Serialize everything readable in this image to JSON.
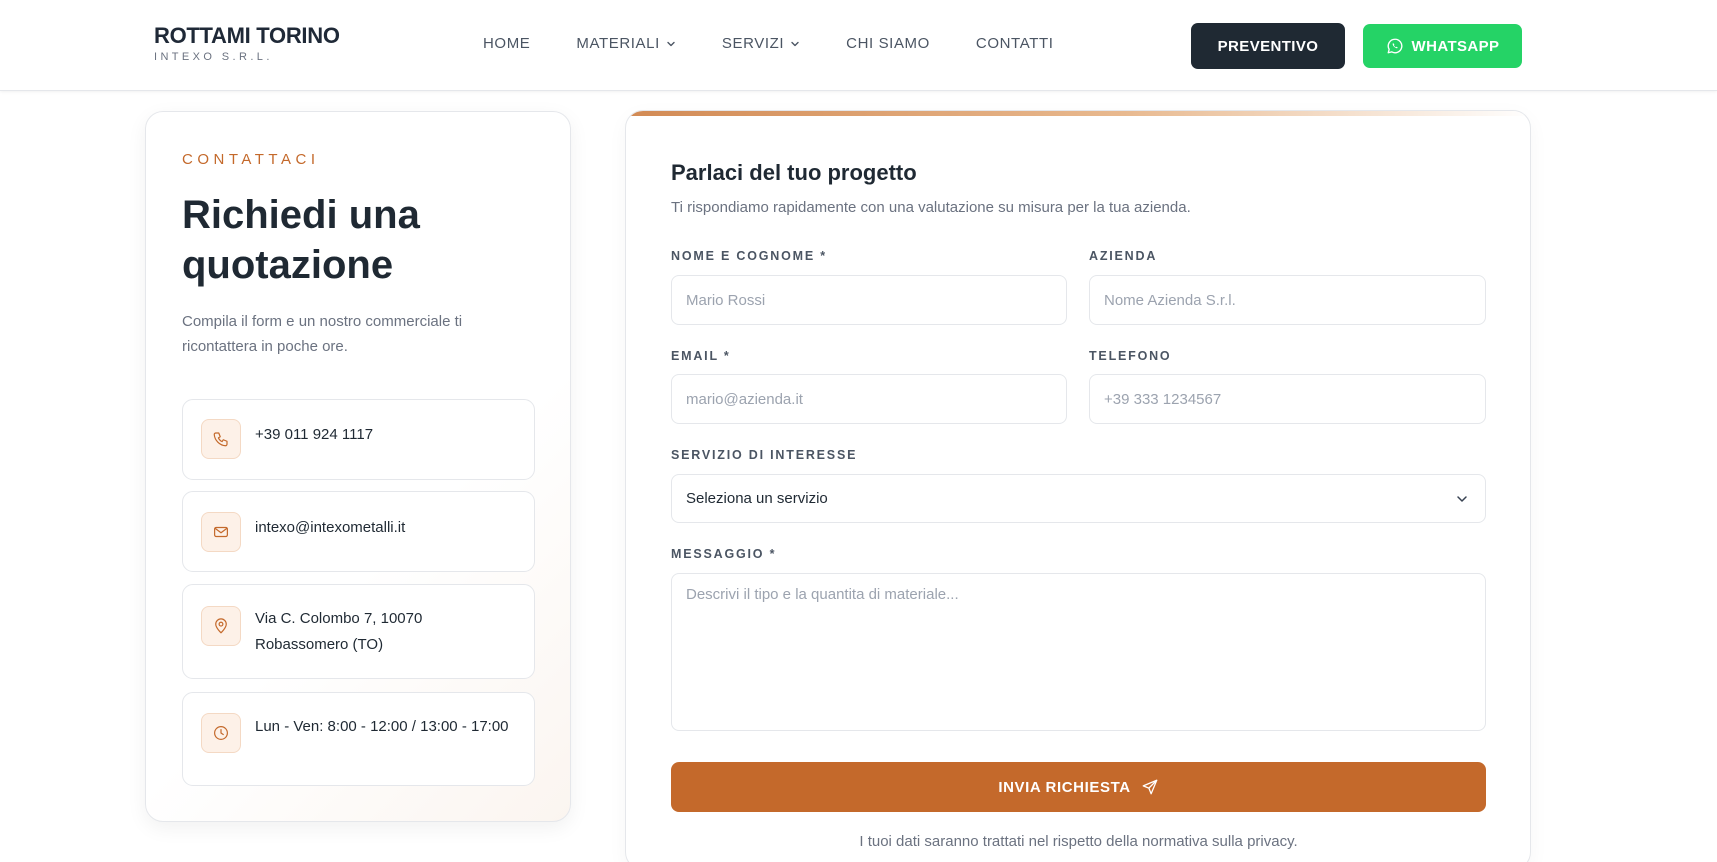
{
  "header": {
    "brand_name": "ROTTAMI TORINO",
    "brand_sub": "INTEXO S.R.L.",
    "nav": [
      {
        "label": "HOME",
        "dropdown": false
      },
      {
        "label": "MATERIALI",
        "dropdown": true
      },
      {
        "label": "SERVIZI",
        "dropdown": true
      },
      {
        "label": "CHI SIAMO",
        "dropdown": false
      },
      {
        "label": "CONTATTI",
        "dropdown": false
      }
    ],
    "preventivo_label": "PREVENTIVO",
    "whatsapp_label": "WHATSAPP"
  },
  "contact": {
    "eyebrow": "CONTATTACI",
    "title": "Richiedi una quotazione",
    "description": "Compila il form e un nostro commerciale ti ricontattera in poche ore.",
    "items": [
      {
        "icon": "phone-icon",
        "text": "+39 011 924 1117"
      },
      {
        "icon": "mail-icon",
        "text": "intexo@intexometalli.it"
      },
      {
        "icon": "location-pin-icon",
        "text": "Via C. Colombo 7, 10070 Robassomero (TO)"
      },
      {
        "icon": "clock-icon",
        "text": "Lun - Ven: 8:00 - 12:00 / 13:00 - 17:00"
      }
    ]
  },
  "form": {
    "title": "Parlaci del tuo progetto",
    "subtitle": "Ti rispondiamo rapidamente con una valutazione su misura per la tua azienda.",
    "name_label": "NOME E COGNOME *",
    "name_placeholder": "Mario Rossi",
    "company_label": "AZIENDA",
    "company_placeholder": "Nome Azienda S.r.l.",
    "email_label": "EMAIL *",
    "email_placeholder": "mario@azienda.it",
    "phone_label": "TELEFONO",
    "phone_placeholder": "+39 333 1234567",
    "service_label": "SERVIZIO DI INTERESSE",
    "service_selected": "Seleziona un servizio",
    "message_label": "MESSAGGIO *",
    "message_placeholder": "Descrivi il tipo e la quantita di materiale...",
    "submit_label": "INVIA RICHIESTA",
    "privacy_note": "I tuoi dati saranno trattati nel rispetto della normativa sulla privacy."
  },
  "colors": {
    "accent": "#c4692b",
    "dark_button": "#1f2933",
    "whatsapp": "#25d366"
  }
}
